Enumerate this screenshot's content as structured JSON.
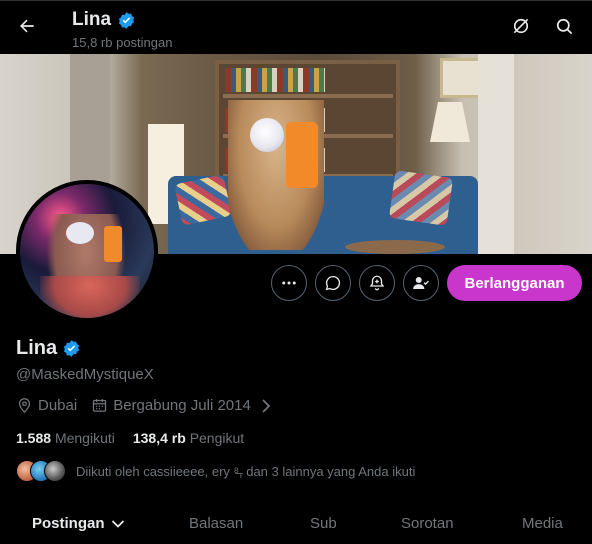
{
  "header": {
    "title": "Lina",
    "post_count": "15,8 rb postingan"
  },
  "icons": {
    "back": "arrow-left-icon",
    "premium": "no-sign-icon",
    "search": "search-icon",
    "more": "more-icon",
    "message": "message-icon",
    "notify": "bell-plus-icon",
    "follow": "person-check-icon",
    "verified": "verified-badge-icon",
    "location": "location-pin-icon",
    "calendar": "calendar-icon"
  },
  "actions": {
    "subscribe_label": "Berlangganan"
  },
  "profile": {
    "name": "Lina",
    "handle": "@MaskedMystiqueX",
    "location": "Dubai",
    "joined": "Bergabung Juli 2014",
    "following_count": "1.588",
    "following_label": "Mengikuti",
    "followers_count": "138,4 rb",
    "followers_label": "Pengikut",
    "followed_by": "Diikuti oleh cassiieeee, ery ⁸̶, dan 3 lainnya yang Anda ikuti"
  },
  "tabs": [
    {
      "label": "Postingan",
      "active": true
    },
    {
      "label": "Balasan",
      "active": false
    },
    {
      "label": "Sub",
      "active": false
    },
    {
      "label": "Sorotan",
      "active": false
    },
    {
      "label": "Media",
      "active": false
    }
  ],
  "colors": {
    "background": "#000000",
    "subscribe": "#c936cc",
    "verified": "#1d9bf0",
    "muted": "#71767b"
  }
}
